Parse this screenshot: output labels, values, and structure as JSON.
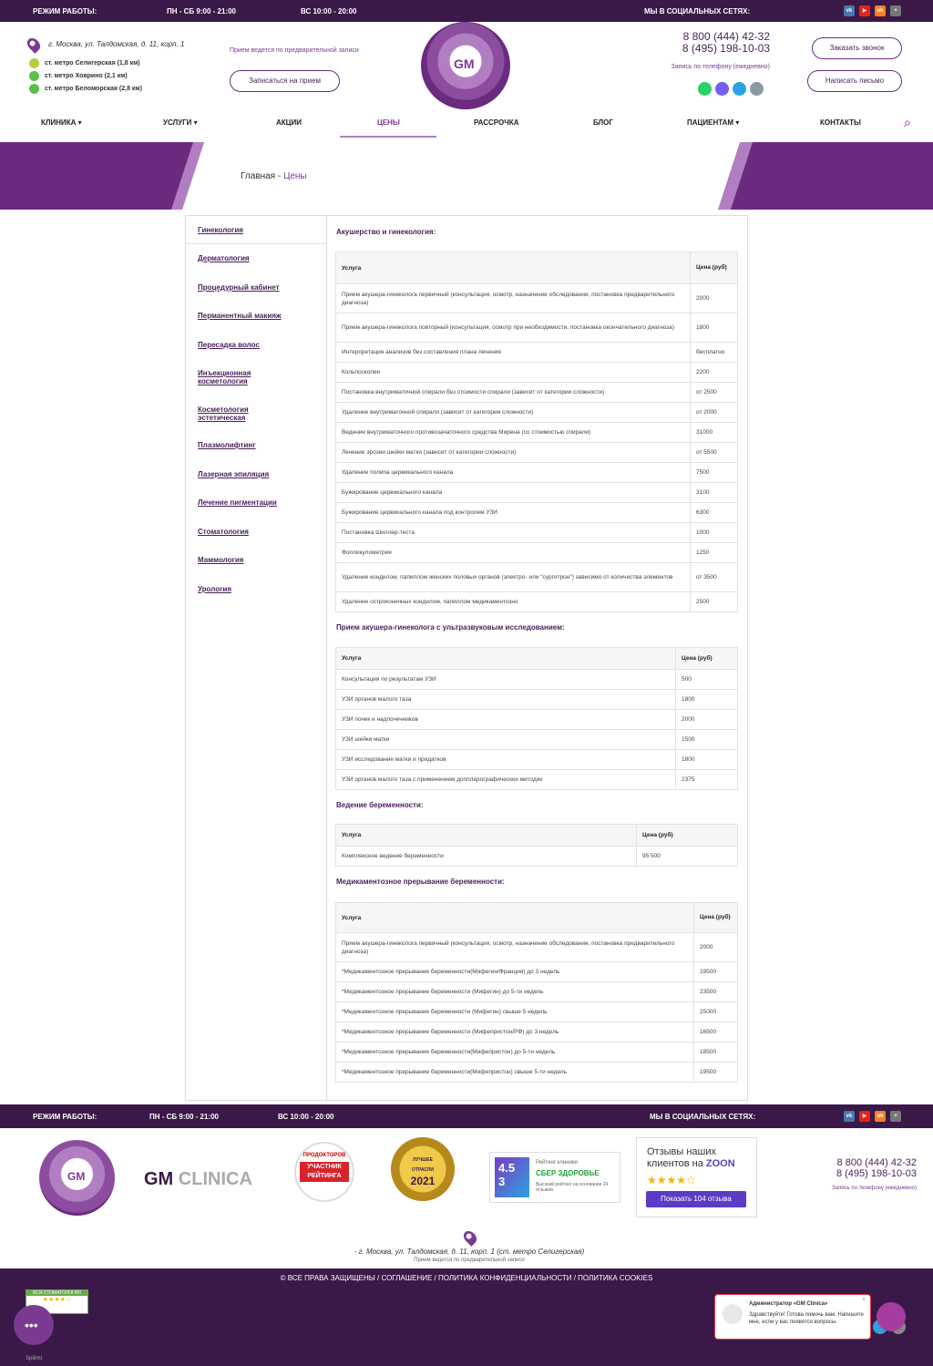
{
  "topbar": {
    "hours_label": "РЕЖИМ РАБОТЫ:",
    "weekdays": "ПН - СБ 9:00 - 21:00",
    "sunday": "ВС 10:00 - 20:00",
    "social_label": "МЫ В СОЦИАЛЬНЫХ СЕТЯХ:"
  },
  "header": {
    "address": "г. Москва, ул. Талдомская, д. 11, корп. 1",
    "metros": [
      "ст. метро Селигерская (1,8 км)",
      "ст. метро Ховрино (2,1 км)",
      "ст. метро Беломорская (2,8 км)"
    ],
    "appointment_note": "Прием ведется по предварительной записи",
    "appointment_btn": "Записаться на прием",
    "logo_text": "GM",
    "phone1": "8 800 (444) 42-32",
    "phone2": "8 (495) 198-10-03",
    "phone_note": "Запись по телефону (ежедневно)",
    "callback_btn": "Заказать звонок",
    "mail_btn": "Написать письмо"
  },
  "nav": [
    "КЛИНИКА",
    "УСЛУГИ",
    "АКЦИИ",
    "ЦЕНЫ",
    "РАССРОЧКА",
    "БЛОГ",
    "ПАЦИЕНТАМ",
    "КОНТАКТЫ"
  ],
  "breadcrumb": {
    "home": "Главная",
    "sep": " - ",
    "current": "Цены"
  },
  "sidebar": [
    "Гинекология",
    "Дерматология",
    "Процедурный кабинет",
    "Перманентный макияж",
    "Пересадка волос",
    "Инъекционная косметология",
    "Косметология эстетическая",
    "Плазмолифтинг",
    "Лазерная эпиляция",
    "Лечение пигментации",
    "Стоматология",
    "Маммология",
    "Урология"
  ],
  "sections": [
    {
      "title": "Акушерство и гинекология:",
      "head": [
        "Услуга",
        "Цена (руб)"
      ],
      "rows": [
        [
          "Прием акушера-гинеколога первичный (консультация, осмотр, назначение обследования, постановка предварительного диагноза)",
          "2000"
        ],
        [
          "Прием акушера-гинеколога повторный (консультация, осмотр при необходимости, постановка окончательного диагноза)",
          "1800"
        ],
        [
          "Интерпретация анализов без составления плана лечения",
          "бесплатно"
        ],
        [
          "Кольпоскопия",
          "2200"
        ],
        [
          "Постановка внутриматочной спирали без стоимости спирали (зависит от категории сложности)",
          "от 2500"
        ],
        [
          "Удаление внутриматочной спирали (зависит от категории сложности)",
          "от 2000"
        ],
        [
          "Ведение внутриматочного противозачаточного средства Мирена (со стоимостью спирали)",
          "31000"
        ],
        [
          "Лечение эрозии шейки матки (зависит от категории сложности)",
          "от 5500"
        ],
        [
          "Удаление полипа цервикального канала",
          "7500"
        ],
        [
          "Бужирование цервикального канала",
          "3100"
        ],
        [
          "Бужирование цервикального канала под контролем УЗИ",
          "6300"
        ],
        [
          "Постановка Шиллер-теста",
          "1000"
        ],
        [
          "Фолликулометрия",
          "1250"
        ],
        [
          "Удаление кондилом, папиллом женских половых органов (электро- или \"сургитрон\") зависимо от количества элементов",
          "от 3500"
        ],
        [
          "Удаление остроконечных кондилом, папиллом медикаментозно",
          "2500"
        ]
      ]
    },
    {
      "title": "Прием акушера-гинеколога с ультразвуковым исследованием:",
      "head": [
        "Услуга",
        "Цена (руб)"
      ],
      "rows": [
        [
          "Консультация по результатам УЗИ",
          "500"
        ],
        [
          "УЗИ органов малого таза",
          "1800"
        ],
        [
          "УЗИ почек и надпочечников",
          "2000"
        ],
        [
          "УЗИ шейки матки",
          "1500"
        ],
        [
          "УЗИ исследование матки и придатков",
          "1800"
        ],
        [
          "УЗИ органов малого таза с применением допплерографических методик",
          "2375"
        ]
      ]
    },
    {
      "title": "Ведение беременности:",
      "head": [
        "Услуга",
        "Цена (руб)"
      ],
      "rows": [
        [
          "Комплексное ведение беременности",
          "95 500"
        ]
      ]
    },
    {
      "title": "Медикаментозное прерывание беременности:",
      "head": [
        "Услуга",
        "Цена (руб)"
      ],
      "rows": [
        [
          "Прием акушера-гинеколога первичный (консультация, осмотр, назначение обследования, постановка предварительного диагноза)",
          "2000"
        ],
        [
          "*Медикаментозное прерывание беременности(Мифегин/Франция) до 3 недель",
          "19500"
        ],
        [
          "*Медикаментозное прерывание беременности (Мифегин) до 5-ти недель",
          "23500"
        ],
        [
          "*Медикаментозное прерывание беременности (Мифегин) свыше 5 недель",
          "25000"
        ],
        [
          "*Медикаментозное прерывание беременности (Мифепристон/РФ) до 3 недель",
          "16500"
        ],
        [
          "*Медикаментозное прерывание беременности(Мифепристон) до 5-ти недель",
          "18500"
        ],
        [
          "*Медикаментозное прерывание беременности(Мифепристон) свыше 5-ти недель",
          "19500"
        ]
      ]
    }
  ],
  "footer": {
    "clinic_name_a": "GM",
    "clinic_name_b": "CLINICA",
    "prodoc": "ПРОДОКТОРОВ",
    "prodoc_badge": "УЧАСТНИК РЕЙТИНГА",
    "best_a": "ЛУЧШЕЕ",
    "best_b": "ОТРАСЛИ",
    "best_year": "2021",
    "sber_score": "4.5",
    "sber_score2": "3",
    "sber_title": "Рейтинг клиники",
    "sber_name": "СБЕР ЗДОРОВЬЕ",
    "sber_note": "Высокий рейтинг на основании 24 отзывов",
    "zoon_title": "Отзывы наших клиентов на",
    "zoon": "ZOON",
    "zoon_btn": "Показать 104 отзыва",
    "address": "г. Москва, ул. Талдомская, д. 11, корп. 1 (ст. метро Селигерская)",
    "note": "Прием ведется по предварительной записи",
    "copyright": "© ВСЕ ПРАВА ЗАЩИЩЕНЫ / СОГЛАШЕНИЕ / ПОЛИТИКА КОНФИДЕНЦИАЛЬНОСТИ / ПОЛИТИКА COOKIES",
    "stom_badge": "ВСЯ СТОМАТОЛОГИЯ"
  },
  "chat": {
    "title": "Администратор «GM Clinica»",
    "text": "Здравствуйте! Готова помочь вам. Напишите мне, если у вас появятся вопросы.",
    "brand": "Spikmi"
  }
}
